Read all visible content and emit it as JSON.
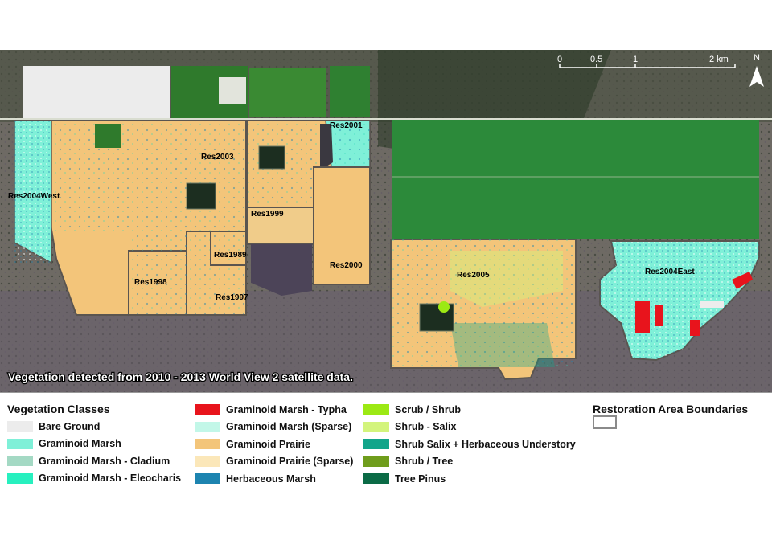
{
  "map": {
    "caption": "Vegetation detected from 2010 - 2013 World View 2 satellite data.",
    "areas": [
      "Res2001",
      "Res2003",
      "Res2004West",
      "Res1999",
      "Res1989",
      "Res1998",
      "Res1997",
      "Res2000",
      "Res2005",
      "Res2004East"
    ],
    "scale_bar": {
      "ticks": [
        "0",
        "0.5",
        "1",
        "2 km"
      ]
    },
    "north_arrow": "N"
  },
  "legend": {
    "vegetation_title": "Vegetation Classes",
    "classes": [
      {
        "label": "Bare Ground",
        "color": "#ececec"
      },
      {
        "label": "Graminoid Marsh",
        "color": "#7ff0d8"
      },
      {
        "label": "Graminoid Marsh - Cladium",
        "color": "#a4d9c4"
      },
      {
        "label": "Graminoid Marsh - Eleocharis",
        "color": "#27f0bf"
      },
      {
        "label": "Graminoid Marsh - Typha",
        "color": "#e8141c"
      },
      {
        "label": "Graminoid Marsh (Sparse)",
        "color": "#c2f7e8"
      },
      {
        "label": "Graminoid Prairie",
        "color": "#f3c57a"
      },
      {
        "label": "Graminoid Prairie (Sparse)",
        "color": "#fbe7b9"
      },
      {
        "label": "Herbaceous Marsh",
        "color": "#1d84b0"
      },
      {
        "label": "Scrub / Shrub",
        "color": "#9ce914"
      },
      {
        "label": "Shrub - Salix",
        "color": "#d3f47c"
      },
      {
        "label": "Shrub Salix + Herbaceous Understory",
        "color": "#12a58a"
      },
      {
        "label": "Shrub / Tree",
        "color": "#6f9d1c"
      },
      {
        "label": "Tree  Pinus",
        "color": "#0b6b46"
      }
    ],
    "boundaries_title": "Restoration Area Boundaries"
  }
}
